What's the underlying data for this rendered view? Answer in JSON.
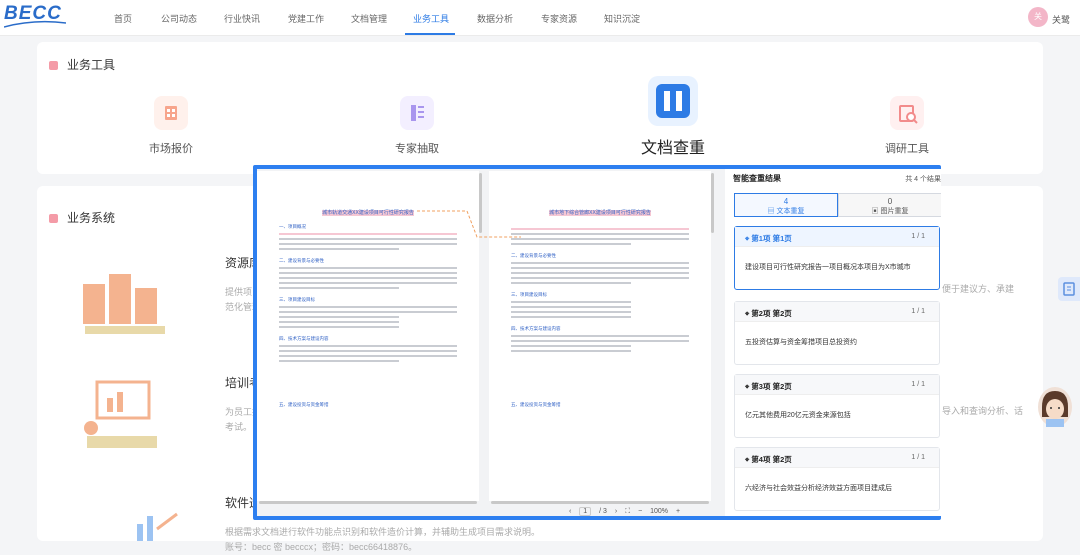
{
  "logo": {
    "text": "BECC"
  },
  "nav": {
    "items": [
      "首页",
      "公司动态",
      "行业快讯",
      "党建工作",
      "文档管理",
      "业务工具",
      "数据分析",
      "专家资源",
      "知识沉淀"
    ],
    "active": "业务工具"
  },
  "user": {
    "avatar": "关",
    "name": "关鹭"
  },
  "tools_section": {
    "title": "业务工具",
    "tools": [
      {
        "label": "市场报价",
        "icon": "building-icon"
      },
      {
        "label": "专家抽取",
        "icon": "bookmark-list-icon"
      },
      {
        "label": "文档查重",
        "icon": "compare-icon"
      },
      {
        "label": "调研工具",
        "icon": "search-report-icon"
      }
    ]
  },
  "systems_section": {
    "title": "业务系统",
    "systems": [
      {
        "title": "资源库",
        "desc1": "提供项目",
        "desc2": "范化管理",
        "right": "便于建议方、承建"
      },
      {
        "title": "培训考",
        "desc1": "为员工提",
        "desc2": "考试。",
        "right": "导入和查询分析、话"
      },
      {
        "title": "软件造",
        "desc1": "根据需求文档进行软件功能点识别和软件造价计算，并辅助生成项目需求说明。",
        "desc2": "账号：becc 密 becccx；密码：becc66418876。"
      }
    ]
  },
  "viewer": {
    "left_doc_title": "城市轨道交通XX建设项目可行性研究报告",
    "left_doc_sections": [
      "一、项目概况",
      "二、建设背景与必要性",
      "三、项目建设目标",
      "四、技术方案与建设内容",
      "五、建设投资与资金筹措"
    ],
    "right_doc_title": "城市地下综合管廊XX建设项目可行性研究报告",
    "right_doc_sections": [
      "二、建设背景与必要性",
      "三、项目建设目标",
      "四、技术方案与建设内容",
      "五、建设投资与资金筹措"
    ],
    "pager": {
      "page": "1",
      "total": "/ 3",
      "zoom": "100%",
      "minus": "−",
      "plus": "+"
    },
    "results": {
      "title": "智能查重结果",
      "count": "共 4 个结果",
      "tab_text": {
        "count": "4",
        "label": "文本重复"
      },
      "tab_image": {
        "count": "0",
        "label": "图片重复"
      },
      "items": [
        {
          "loc": "第1项 第1页",
          "frac": "1 / 1",
          "text": "建设项目可行性研究报告一项目概况本项目为X市城市"
        },
        {
          "loc": "第2项 第2页",
          "frac": "1 / 1",
          "text": "五投资估算与资金筹措项目总投资约"
        },
        {
          "loc": "第3项 第2页",
          "frac": "1 / 1",
          "text": "亿元其他费用20亿元资金来源包括"
        },
        {
          "loc": "第4项 第2页",
          "frac": "1 / 1",
          "text": "六经济与社会效益分析经济效益方面项目建成后"
        }
      ]
    }
  },
  "colors": {
    "accent": "#2d7be5",
    "highlight": "#f6c7d3",
    "viewer_border": "#2d7ff0"
  }
}
